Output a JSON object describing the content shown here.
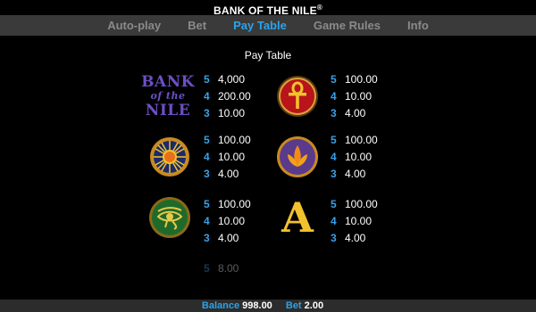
{
  "game": {
    "title": "BANK OF THE NILE",
    "reg_mark": "®"
  },
  "tabs": [
    {
      "label": "Auto-play",
      "active": false
    },
    {
      "label": "Bet",
      "active": false
    },
    {
      "label": "Pay Table",
      "active": true
    },
    {
      "label": "Game Rules",
      "active": false
    },
    {
      "label": "Info",
      "active": false
    }
  ],
  "paytable": {
    "heading": "Pay Table",
    "symbols": [
      {
        "name": "bank-of-the-nile-logo",
        "logo_text": [
          "BANK",
          "of the",
          "NILE"
        ],
        "pays": [
          {
            "count": "5",
            "amount": "4,000"
          },
          {
            "count": "4",
            "amount": "200.00"
          },
          {
            "count": "3",
            "amount": "10.00"
          }
        ]
      },
      {
        "name": "ankh-icon",
        "pays": [
          {
            "count": "5",
            "amount": "100.00"
          },
          {
            "count": "4",
            "amount": "10.00"
          },
          {
            "count": "3",
            "amount": "4.00"
          }
        ]
      },
      {
        "name": "sun-medallion-icon",
        "pays": [
          {
            "count": "5",
            "amount": "100.00"
          },
          {
            "count": "4",
            "amount": "10.00"
          },
          {
            "count": "3",
            "amount": "4.00"
          }
        ]
      },
      {
        "name": "lotus-icon",
        "pays": [
          {
            "count": "5",
            "amount": "100.00"
          },
          {
            "count": "4",
            "amount": "10.00"
          },
          {
            "count": "3",
            "amount": "4.00"
          }
        ]
      },
      {
        "name": "eye-of-horus-icon",
        "pays": [
          {
            "count": "5",
            "amount": "100.00"
          },
          {
            "count": "4",
            "amount": "10.00"
          },
          {
            "count": "3",
            "amount": "4.00"
          }
        ]
      },
      {
        "name": "letter-a-icon",
        "glyph": "A",
        "pays": [
          {
            "count": "5",
            "amount": "100.00"
          },
          {
            "count": "4",
            "amount": "10.00"
          },
          {
            "count": "3",
            "amount": "4.00"
          }
        ]
      }
    ],
    "partial_row": {
      "count": "5",
      "amount": "8.00"
    }
  },
  "footer": {
    "balance_label": "Balance",
    "balance_value": "998.00",
    "bet_label": "Bet",
    "bet_value": "2.00"
  },
  "colors": {
    "accent": "#2ba3ea",
    "inactive_tab": "#8a8a8a",
    "tabbar_bg": "#3a3a3a",
    "gold": "#f2c12e"
  }
}
